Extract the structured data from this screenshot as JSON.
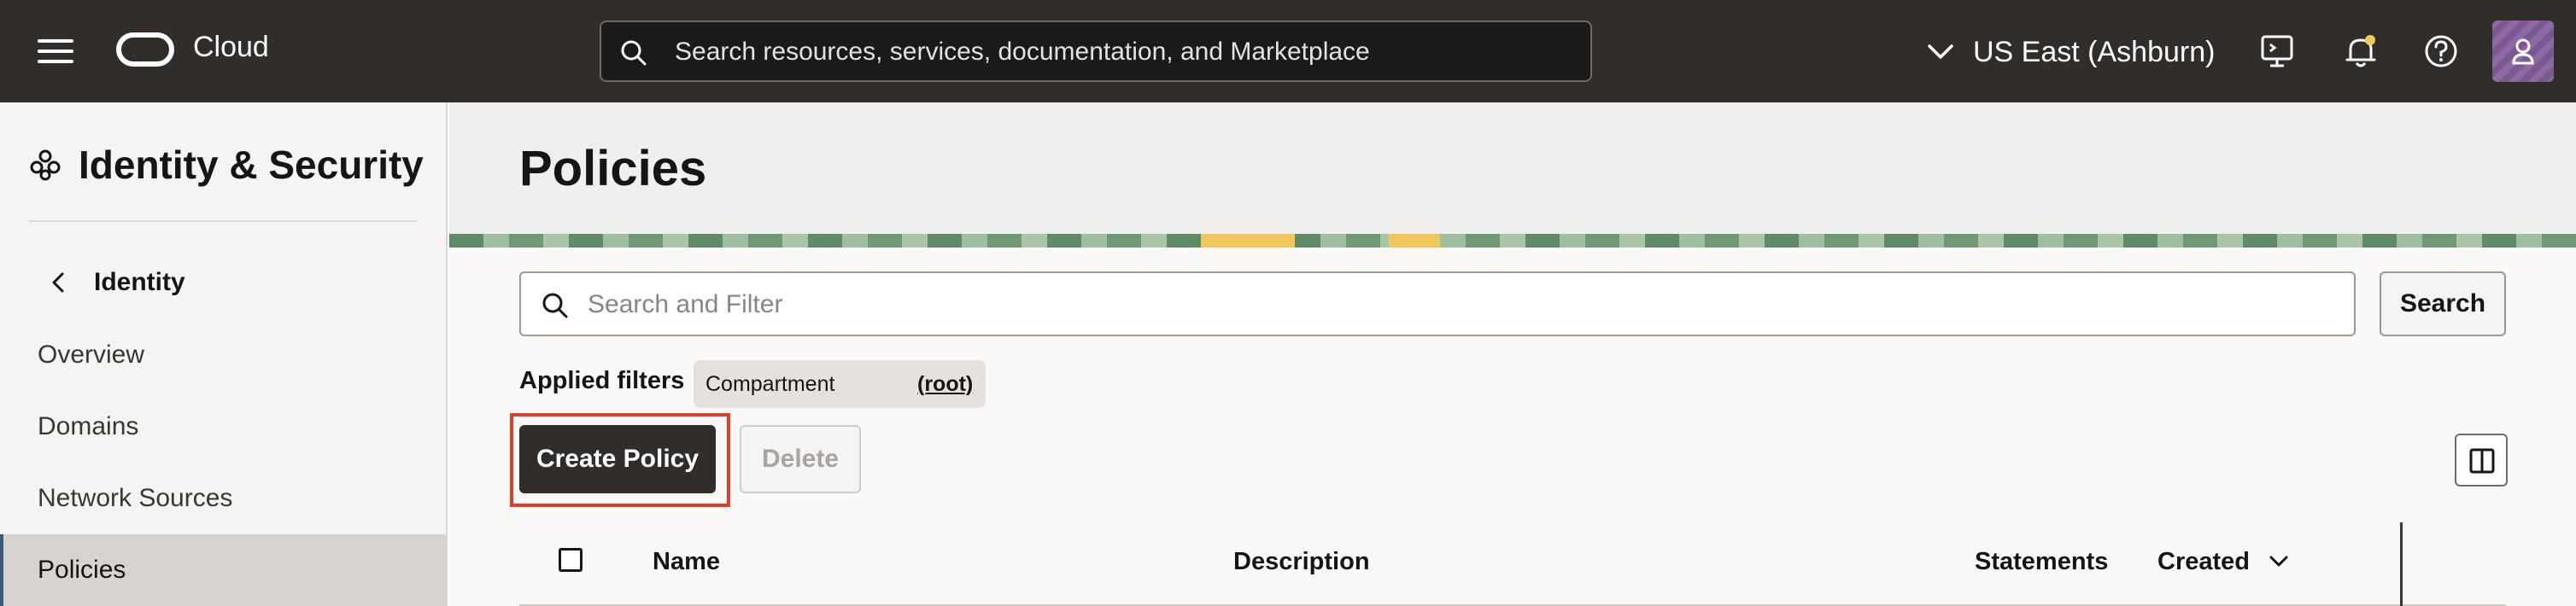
{
  "topbar": {
    "brand": "Cloud",
    "search_placeholder": "Search resources, services, documentation, and Marketplace",
    "region": "US East (Ashburn)",
    "icons": [
      "menu-icon",
      "oracle-logo-icon",
      "search-icon",
      "chevron-down-icon",
      "cloud-shell-icon",
      "bell-icon",
      "help-icon",
      "user-icon"
    ]
  },
  "sidebar": {
    "title": "Identity & Security",
    "back_label": "Identity",
    "items": [
      {
        "label": "Overview",
        "active": false
      },
      {
        "label": "Domains",
        "active": false
      },
      {
        "label": "Network Sources",
        "active": false
      },
      {
        "label": "Policies",
        "active": true
      }
    ]
  },
  "main": {
    "title": "Policies",
    "filter_placeholder": "Search and Filter",
    "search_button": "Search",
    "applied_filters_label": "Applied filters",
    "chip": {
      "label": "Compartment",
      "value": "(root)"
    },
    "create_button": "Create Policy",
    "delete_button": "Delete",
    "table": {
      "columns": [
        "Name",
        "Description",
        "Statements",
        "Created"
      ]
    }
  },
  "colors": {
    "topbar": "#312d2a",
    "primary_button": "#312d2a",
    "highlight_outline": "#e0402a",
    "notification_dot": "#f0c85c"
  }
}
